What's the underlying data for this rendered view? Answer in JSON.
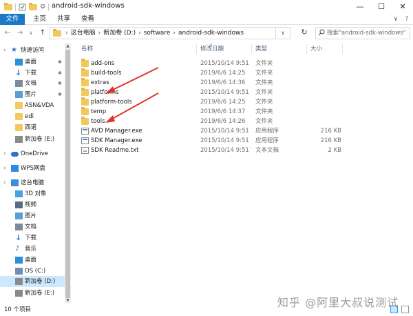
{
  "window": {
    "title": "android-sdk-windows",
    "minimize_glyph": "—",
    "maximize_glyph": "☐",
    "close_glyph": "✕"
  },
  "ribbon": {
    "tabs": [
      "文件",
      "主页",
      "共享",
      "查看"
    ],
    "collapse_glyph": "∨",
    "help_glyph": "?"
  },
  "nav": {
    "back_glyph": "←",
    "forward_glyph": "→",
    "recent_glyph": "∨",
    "up_glyph": "↑",
    "breadcrumbs": [
      "这台电脑",
      "新加卷 (D:)",
      "software",
      "android-sdk-windows"
    ],
    "refresh_glyph": "↻",
    "search_placeholder": "搜索\"android-sdk-windows\""
  },
  "sidebar": {
    "items": [
      {
        "label": "快速访问",
        "icon": "star-icon",
        "pinned": false
      },
      {
        "label": "桌面",
        "icon": "desktop-icon",
        "pinned": true
      },
      {
        "label": "下载",
        "icon": "download-icon",
        "pinned": true
      },
      {
        "label": "文档",
        "icon": "documents-icon",
        "pinned": true
      },
      {
        "label": "图片",
        "icon": "pictures-icon",
        "pinned": true
      },
      {
        "label": "ASN&VDA",
        "icon": "folder-icon",
        "pinned": false
      },
      {
        "label": "edi",
        "icon": "folder-icon",
        "pinned": false
      },
      {
        "label": "西诺",
        "icon": "folder-icon",
        "pinned": false
      },
      {
        "label": "新加卷 (E:)",
        "icon": "drive-icon",
        "pinned": false
      },
      {
        "label": "OneDrive",
        "icon": "cloud-icon",
        "pinned": false
      },
      {
        "label": "WPS网盘",
        "icon": "wps-cloud-icon",
        "pinned": false
      },
      {
        "label": "这台电脑",
        "icon": "computer-icon",
        "pinned": false
      },
      {
        "label": "3D 对象",
        "icon": "3d-objects-icon",
        "pinned": false
      },
      {
        "label": "视频",
        "icon": "videos-icon",
        "pinned": false
      },
      {
        "label": "图片",
        "icon": "pictures-icon",
        "pinned": false
      },
      {
        "label": "文档",
        "icon": "documents-icon",
        "pinned": false
      },
      {
        "label": "下载",
        "icon": "download-icon",
        "pinned": false
      },
      {
        "label": "音乐",
        "icon": "music-icon",
        "pinned": false
      },
      {
        "label": "桌面",
        "icon": "desktop-icon",
        "pinned": false
      },
      {
        "label": "OS (C:)",
        "icon": "drive-c-icon",
        "pinned": false
      },
      {
        "label": "新加卷 (D:)",
        "icon": "drive-icon",
        "pinned": false,
        "selected": true
      },
      {
        "label": "新加卷 (E:)",
        "icon": "drive-icon",
        "pinned": false
      }
    ]
  },
  "list": {
    "columns": {
      "name": "名称",
      "date": "修改日期",
      "type": "类型",
      "size": "大小"
    },
    "rows": [
      {
        "name": "add-ons",
        "date": "2015/10/14 9:51",
        "type": "文件夹",
        "size": "",
        "kind": "folder"
      },
      {
        "name": "build-tools",
        "date": "2019/6/6 14:25",
        "type": "文件夹",
        "size": "",
        "kind": "folder"
      },
      {
        "name": "extras",
        "date": "2019/6/6 14:36",
        "type": "文件夹",
        "size": "",
        "kind": "folder"
      },
      {
        "name": "platforms",
        "date": "2015/10/14 9:51",
        "type": "文件夹",
        "size": "",
        "kind": "folder"
      },
      {
        "name": "platform-tools",
        "date": "2019/6/6 14:25",
        "type": "文件夹",
        "size": "",
        "kind": "folder"
      },
      {
        "name": "temp",
        "date": "2019/6/6 14:37",
        "type": "文件夹",
        "size": "",
        "kind": "folder"
      },
      {
        "name": "tools",
        "date": "2019/6/6 14:26",
        "type": "文件夹",
        "size": "",
        "kind": "folder"
      },
      {
        "name": "AVD Manager.exe",
        "date": "2015/10/14 9:51",
        "type": "应用程序",
        "size": "216 KB",
        "kind": "exe"
      },
      {
        "name": "SDK Manager.exe",
        "date": "2015/10/14 9:51",
        "type": "应用程序",
        "size": "216 KB",
        "kind": "exe"
      },
      {
        "name": "SDK Readme.txt",
        "date": "2015/10/14 9:51",
        "type": "文本文档",
        "size": "2 KB",
        "kind": "txt"
      }
    ]
  },
  "status": {
    "item_count": "10 个项目"
  },
  "watermark": "知乎 @阿里大叔说测试",
  "colors": {
    "accent": "#1979ca",
    "selection": "#cce8ff",
    "annotation_arrow": "#e0342b",
    "folder": "#f2c95d"
  }
}
